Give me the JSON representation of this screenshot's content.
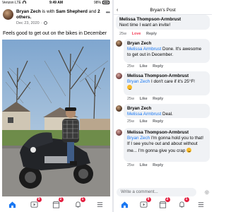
{
  "left": {
    "status": {
      "carrier": "Verizon LTE",
      "time": "9:49 AM",
      "battery": "98%"
    },
    "post": {
      "author": "Bryan Zech",
      "with_text": "is with",
      "tagged": "Sam Shepherd",
      "and_text": "and",
      "others": "2 others.",
      "date": "Dec 23, 2020",
      "text": "Feels good to get out on the bikes in December"
    }
  },
  "nav": {
    "badges": {
      "watch": "9",
      "marketplace": "2",
      "notifications": "1"
    }
  },
  "right": {
    "title": "Bryan's Post",
    "comments": [
      {
        "author": "Melissa Thompson-Armbrust",
        "text": "Next time I want an invite!",
        "time": "25w",
        "reaction": "Love",
        "reply": "Reply"
      },
      {
        "author": "Bryan Zech",
        "tag": "Melissa Armbrust",
        "text": " Done. It's awesome to get out in December.",
        "time": "25w",
        "like": "Like",
        "reply": "Reply"
      },
      {
        "author": "Melissa Thompson-Armbrust",
        "tag": "Bryan Zech",
        "text": " I don't care if it's 25°F!",
        "time": "25w",
        "like": "Like",
        "reply": "Reply"
      },
      {
        "author": "Bryan Zech",
        "tag": "Melissa Armbrust",
        "text": " Deal.",
        "time": "25w",
        "like": "Like",
        "reply": "Reply"
      },
      {
        "author": "Melissa Thompson-Armbrust",
        "tag": "Bryan Zech",
        "text": " I'm gonna hold you to that! If I see you're out and about without me... I'm gonna give you crap",
        "time": "25w",
        "like": "Like",
        "reply": "Reply"
      }
    ],
    "write_placeholder": "Write a comment..."
  },
  "colors": {
    "accent": "#1877f2",
    "love": "#f33e58",
    "badge": "#e41e3f"
  }
}
